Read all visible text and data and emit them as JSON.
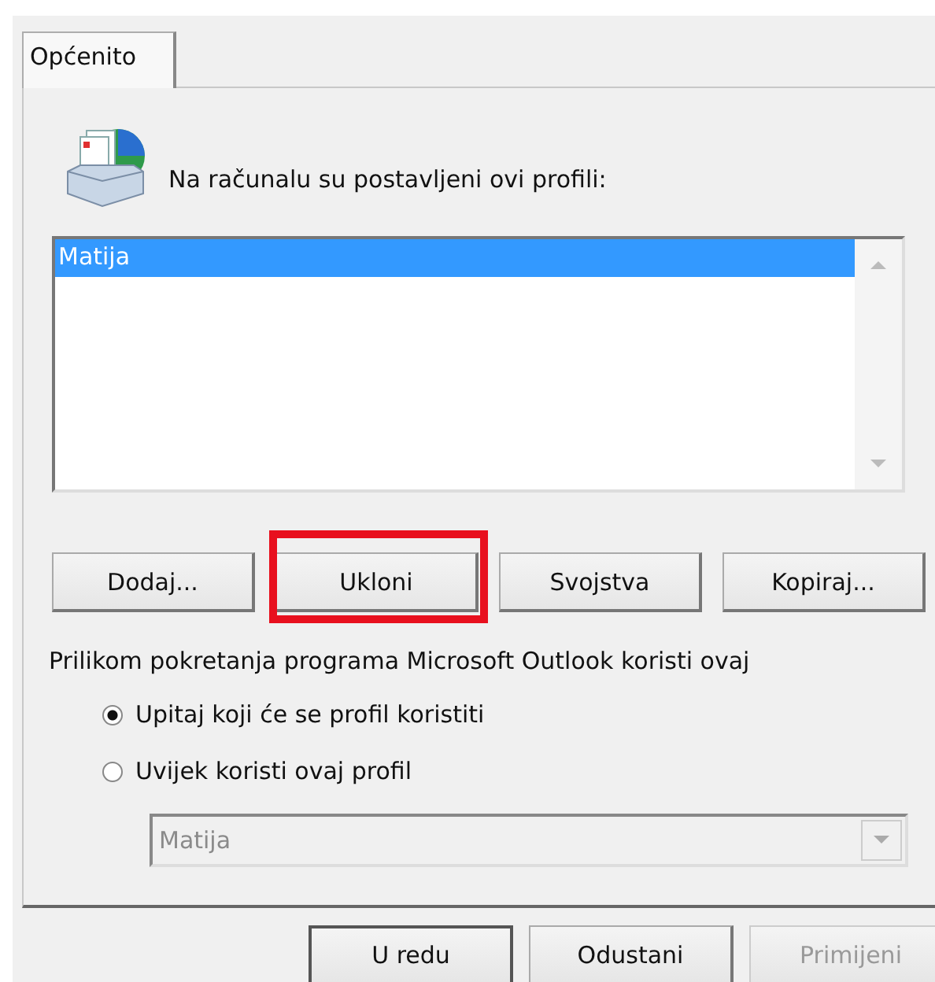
{
  "tabs": [
    {
      "label": "Općenito",
      "selected": true
    }
  ],
  "header": {
    "label": "Na računalu su postavljeni ovi profili:"
  },
  "profiles": [
    {
      "name": "Matija",
      "selected": true
    }
  ],
  "profile_buttons": [
    {
      "label": "Dodaj...",
      "highlighted": false
    },
    {
      "label": "Ukloni",
      "highlighted": true
    },
    {
      "label": "Svojstva",
      "highlighted": false
    },
    {
      "label": "Kopiraj...",
      "highlighted": false
    }
  ],
  "startup": {
    "label": "Prilikom pokretanja programa Microsoft Outlook koristi ovaj",
    "options": [
      {
        "label": "Upitaj koji će se profil koristiti",
        "selected": true
      },
      {
        "label": "Uvijek koristi ovaj profil",
        "selected": false
      }
    ],
    "profile_select": {
      "value": "Matija",
      "disabled": true
    }
  },
  "dialog_buttons": [
    {
      "label": "U redu",
      "disabled": false,
      "default": true
    },
    {
      "label": "Odustani",
      "disabled": false,
      "default": false
    },
    {
      "label": "Primijeni",
      "disabled": true,
      "default": false
    }
  ]
}
